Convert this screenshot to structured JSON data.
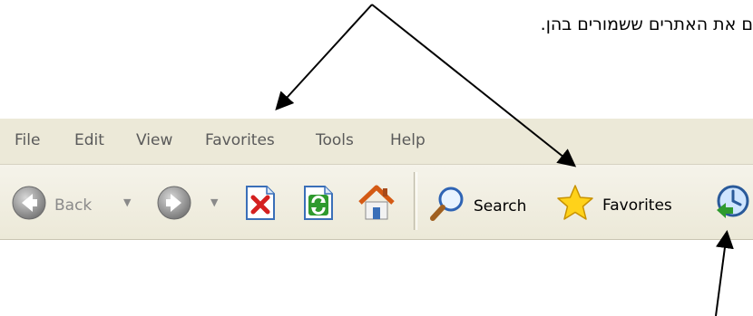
{
  "caption": "ם את האתרים ששמורים בהן.",
  "menu": {
    "items": [
      "File",
      "Edit",
      "View",
      "Favorites",
      "Tools",
      "Help"
    ]
  },
  "toolbar": {
    "back_label": "Back",
    "search_label": "Search",
    "favorites_label": "Favorites"
  },
  "icons": {
    "back": "back-arrow-icon",
    "forward": "forward-arrow-icon",
    "stop": "stop-icon",
    "refresh": "refresh-icon",
    "home": "home-icon",
    "search": "magnifier-icon",
    "favorites": "star-icon",
    "history": "history-icon"
  },
  "colors": {
    "menubar_bg": "#ece9d8",
    "disabled_arrow": "#8c8c8c",
    "stop_red": "#d42020",
    "refresh_green": "#2e9a2e",
    "star_yellow": "#ffd21a"
  }
}
